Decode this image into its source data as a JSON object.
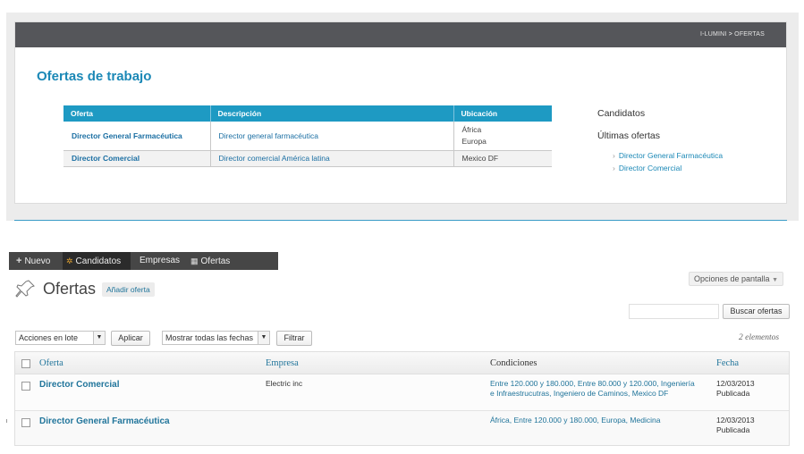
{
  "site": {
    "breadcrumb": {
      "home": "I-LUMINI",
      "separator": ">",
      "current": "OFERTAS"
    },
    "title": "Ofertas de trabajo",
    "table": {
      "headers": [
        "Oferta",
        "Descripción",
        "Ubicación"
      ],
      "rows": [
        {
          "oferta": "Director General Farmacéutica",
          "descripcion": "Director general farmacéutica",
          "ubicacion": [
            "África",
            "Europa"
          ]
        },
        {
          "oferta": "Director Comercial",
          "descripcion": "Director comercial América latina",
          "ubicacion": [
            "Mexico DF"
          ]
        }
      ]
    },
    "sidebar": {
      "heading1": "Candidatos",
      "heading2": "Últimas ofertas",
      "items": [
        "Director General Farmacéutica",
        "Director Comercial"
      ]
    }
  },
  "admin": {
    "adminbar": {
      "nuevo": "Nuevo",
      "candidatos": "Candidatos",
      "empresas": "Empresas",
      "ofertas": "Ofertas"
    },
    "screen_options": "Opciones de pantalla",
    "page_title": "Ofertas",
    "add_new": "Añadir oferta",
    "search_button": "Buscar ofertas",
    "search_value": "",
    "bulk_select": "Acciones en lote",
    "apply": "Aplicar",
    "dates_select": "Mostrar todas las fechas",
    "filter": "Filtrar",
    "count": "2 elementos",
    "columns": [
      "Oferta",
      "Empresa",
      "Condiciones",
      "Fecha"
    ],
    "rows": [
      {
        "title": "Director Comercial",
        "empresa": "Electric inc",
        "condiciones": "Entre 120.000 y 180.000, Entre 80.000 y 120.000, Ingeniería e Infraestrucutras, Ingeniero de Caminos, Mexico DF",
        "fecha": "12/03/2013",
        "estado": "Publicada"
      },
      {
        "title": "Director General Farmacéutica",
        "empresa": "",
        "condiciones": "África, Entre 120.000 y 180.000, Europa, Medicina",
        "fecha": "12/03/2013",
        "estado": "Publicada"
      }
    ]
  },
  "colors": {
    "accent": "#1e9ac3",
    "link": "#21759b",
    "adminbar": "#464646"
  }
}
